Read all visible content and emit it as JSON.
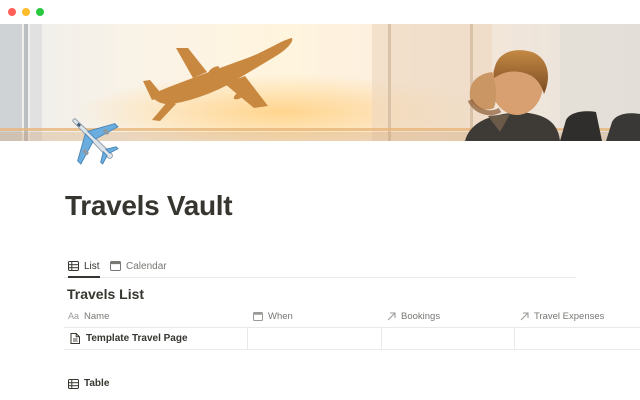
{
  "page": {
    "title": "Travels Vault",
    "cover_image": "airplane-taking-off-and-man-watching-from-airport-window",
    "icon": "airplane-emoji"
  },
  "views": {
    "tabs": [
      {
        "label": "List",
        "icon": "table-icon",
        "active": true
      },
      {
        "label": "Calendar",
        "icon": "calendar-icon",
        "active": false
      }
    ]
  },
  "database": {
    "title": "Travels List",
    "columns": [
      {
        "label": "Name",
        "icon": "text-aa-icon"
      },
      {
        "label": "When",
        "icon": "calendar-icon"
      },
      {
        "label": "Bookings",
        "icon": "arrow-up-right-icon"
      },
      {
        "label": "Travel Expenses",
        "icon": "arrow-up-right-icon"
      }
    ],
    "rows": [
      {
        "name": "Template Travel Page",
        "when": "",
        "bookings": "",
        "travel_expenses": ""
      }
    ]
  },
  "second_view": {
    "label": "Table",
    "icon": "table-icon"
  },
  "colors": {
    "text": "#37352f",
    "muted": "#787774",
    "border": "#e9e9e7",
    "cover_glow": "#f6a23a"
  }
}
